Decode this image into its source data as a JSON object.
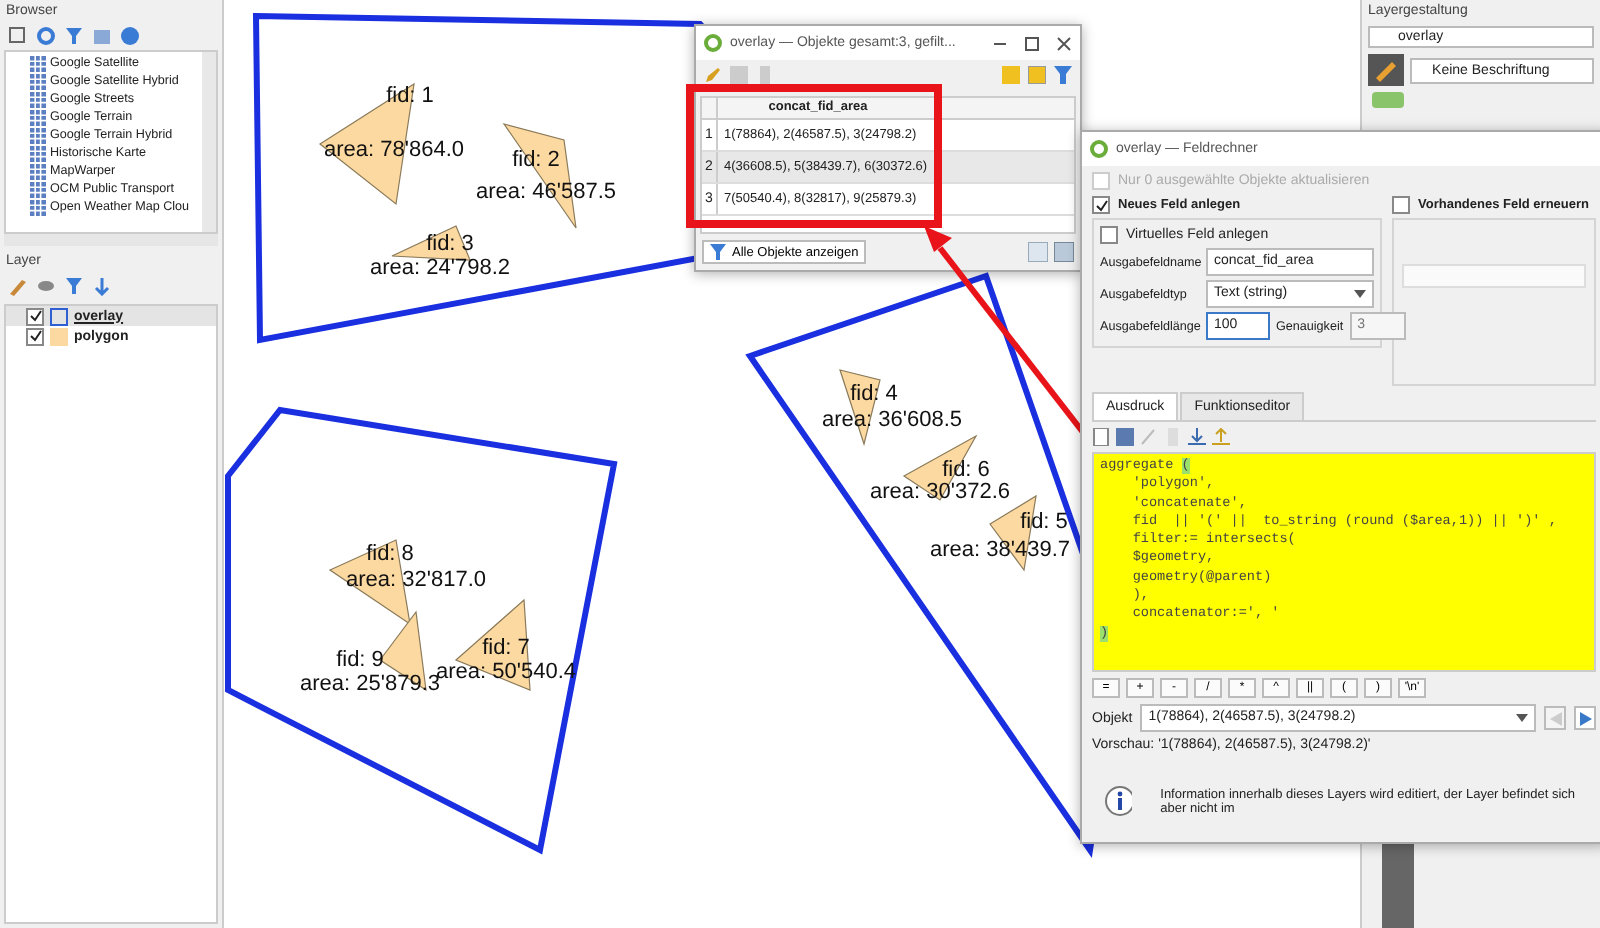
{
  "browser": {
    "title": "Browser",
    "items": [
      "Google Satellite",
      "Google Satellite Hybrid",
      "Google Streets",
      "Google Terrain",
      "Google Terrain Hybrid",
      "Historische Karte",
      "MapWarper",
      "OCM Public Transport",
      "Open Weather Map Clou"
    ]
  },
  "layers": {
    "title": "Layer",
    "items": [
      {
        "name": "overlay",
        "checked": true,
        "selected": true,
        "color": "#2f5fd0"
      },
      {
        "name": "polygon",
        "checked": true,
        "selected": false,
        "color": "#fcd9a0"
      }
    ]
  },
  "map": {
    "features": [
      {
        "fid": "fid: 1",
        "area": "area: 78'864.0"
      },
      {
        "fid": "fid: 2",
        "area": "area: 46'587.5"
      },
      {
        "fid": "fid: 3",
        "area": "area: 24'798.2"
      },
      {
        "fid": "fid: 4",
        "area": "area: 36'608.5"
      },
      {
        "fid": "fid: 6",
        "area": "area: 30'372.6"
      },
      {
        "fid": "fid: 5",
        "area": "area: 38'439.7"
      },
      {
        "fid": "fid: 8",
        "area": "area: 32'817.0"
      },
      {
        "fid": "fid: 7",
        "area": "area: 50'540.4"
      },
      {
        "fid": "fid: 9",
        "area": "area: 25'879.3"
      }
    ]
  },
  "attribute_table": {
    "title": "overlay — Objekte gesamt:3, gefilt...",
    "column": "concat_fid_area",
    "rows": [
      {
        "num": "1",
        "value": "1(78864), 2(46587.5), 3(24798.2)"
      },
      {
        "num": "2",
        "value": "4(36608.5), 5(38439.7), 6(30372.6)"
      },
      {
        "num": "3",
        "value": "7(50540.4), 8(32817), 9(25879.3)"
      }
    ],
    "filter_button": "Alle Objekte anzeigen"
  },
  "field_calculator": {
    "title": "overlay — Feldrechner",
    "update_selected": {
      "label": "Nur 0 ausgewählte Objekte aktualisieren",
      "checked": false,
      "disabled": true
    },
    "new_field": {
      "label": "Neues Feld anlegen",
      "checked": true
    },
    "update_existing": {
      "label": "Vorhandenes Feld erneuern",
      "checked": false
    },
    "virtual": {
      "label": "Virtuelles Feld anlegen",
      "checked": false
    },
    "fields": [
      {
        "label": "Ausgabefeldname",
        "value": "concat_fid_area",
        "kind": "text"
      },
      {
        "label": "Ausgabefeldtyp",
        "value": "Text (string)",
        "kind": "select"
      }
    ],
    "length": {
      "label": "Ausgabefeldlänge",
      "value": "100"
    },
    "precision": {
      "label": "Genauigkeit",
      "value": "3",
      "disabled": true
    },
    "tabs": [
      {
        "label": "Ausdruck",
        "selected": true
      },
      {
        "label": "Funktionseditor",
        "selected": false
      }
    ],
    "code": [
      {
        "text": "aggregate ",
        "match": "("
      },
      {
        "text": "    'polygon',"
      },
      {
        "text": "    'concatenate',"
      },
      {
        "text": "    fid  || '(' ||  to_string (round ($area,1)) || ')' ,"
      },
      {
        "text": "    filter:= intersects("
      },
      {
        "text": "    $geometry,"
      },
      {
        "text": "    geometry(@parent)"
      },
      {
        "text": "    ),"
      },
      {
        "text": "    concatenator:=', '"
      },
      {
        "match": ")"
      }
    ],
    "operators": [
      "=",
      "+",
      "-",
      "/",
      "*",
      "^",
      "||",
      "(",
      ")",
      "'\\n'"
    ],
    "object": {
      "label": "Objekt",
      "value": "1(78864), 2(46587.5), 3(24798.2)"
    },
    "preview": {
      "label": "Vorschau:",
      "value": "'1(78864), 2(46587.5), 3(24798.2)'"
    },
    "message": "Information innerhalb dieses Layers wird editiert, der Layer befindet sich aber nicht im"
  },
  "layer_styling": {
    "title": "Layergestaltung",
    "layer": "overlay",
    "labels": "Keine Beschriftung"
  }
}
